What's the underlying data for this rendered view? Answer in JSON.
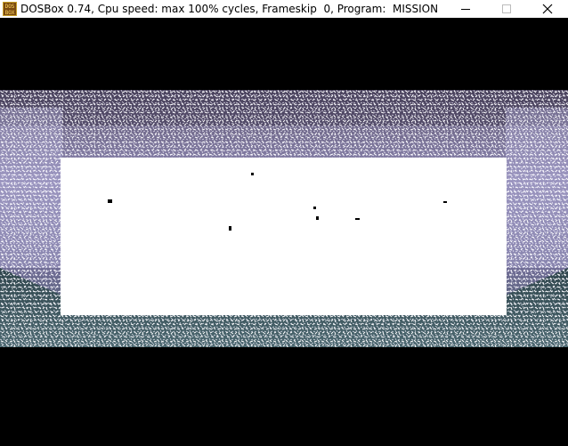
{
  "window": {
    "title": "DOSBox 0.74, Cpu speed: max 100% cycles, Frameskip  0, Program:  MISSION",
    "icon": "dosbox-icon",
    "controls": [
      "minimize-icon",
      "maximize-icon",
      "close-icon"
    ]
  },
  "game": {
    "program": "MISSION",
    "scene": "cave-tunnel",
    "colors": {
      "background": "#000000",
      "rock_light": "#b8b0d6",
      "rock_dark": "#3c3a5a",
      "floor": "#3f5a62",
      "panel": "#ffffff"
    }
  }
}
